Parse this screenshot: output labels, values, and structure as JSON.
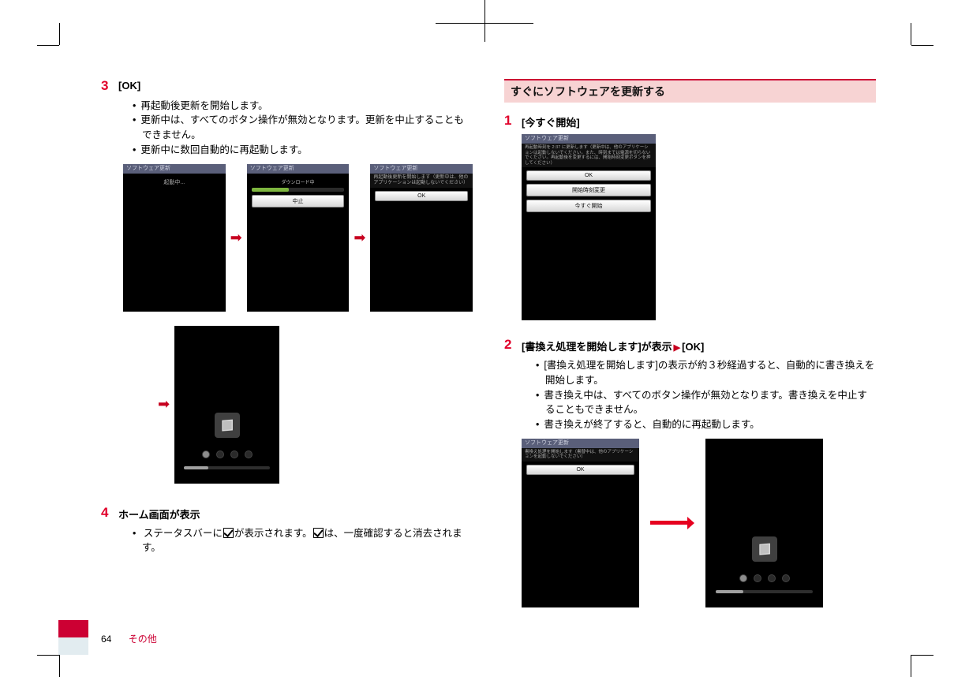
{
  "left": {
    "step3": {
      "num": "3",
      "title": "[OK]",
      "bullets": [
        "再起動後更新を開始します。",
        "更新中は、すべてのボタン操作が無効となります。更新を中止することもできません。",
        "更新中に数回自動的に再起動します。"
      ],
      "screens": {
        "s1_title": "ソフトウェア更新",
        "s1_text": "起動中...",
        "s2_title": "ソフトウェア更新",
        "s2_dl": "ダウンロード中",
        "s2_btn": "中止",
        "s3_title": "ソフトウェア更新",
        "s3_msg": "再起動後更新を開始します（更新中は、他のアプリケーションは起動しないでください）",
        "s3_btn": "OK"
      }
    },
    "step4": {
      "num": "4",
      "title": "ホーム画面が表示",
      "text_a": "ステータスバーに",
      "text_b": "が表示されます。",
      "text_c": "は、一度確認すると消去されます。"
    }
  },
  "right": {
    "heading": "すぐにソフトウェアを更新する",
    "step1": {
      "num": "1",
      "title": "[今すぐ開始]",
      "screen": {
        "title": "ソフトウェア更新",
        "msg": "再起動時刻を 2:37 に更新します（更新中は、他のアプリケーションは起動しないでください。また、時刻までは電源を切らないでください。再起動後を変更するには、開始時刻変更ボタンを押してください）",
        "btn1": "OK",
        "btn2": "開始時刻変更",
        "btn3": "今すぐ開始"
      }
    },
    "step2": {
      "num": "2",
      "title_a": "[書換え処理を開始します]が表示",
      "title_b": "[OK]",
      "bullets": [
        "[書換え処理を開始します]の表示が約３秒経過すると、自動的に書き換えを開始します。",
        "書き換え中は、すべてのボタン操作が無効となります。書き換えを中止することもできません。",
        "書き換えが終了すると、自動的に再起動します。"
      ],
      "screen": {
        "title": "ソフトウェア更新",
        "msg": "書換え処理を開始します（書替中は、他のアプリケーションを起動しないでください）",
        "btn": "OK"
      }
    }
  },
  "footer": {
    "page": "64",
    "label": "その他"
  }
}
